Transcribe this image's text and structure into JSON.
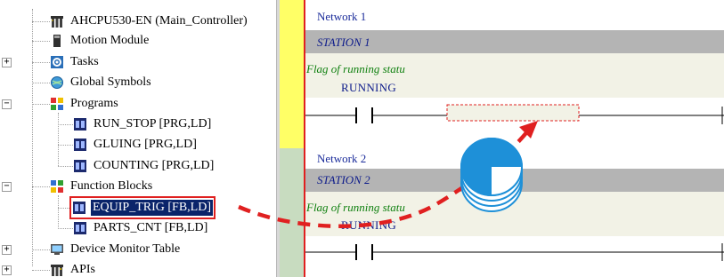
{
  "tree": {
    "items": [
      {
        "label": "AHCPU530-EN  (Main_Controller)",
        "icon": "plc-cpu-icon"
      },
      {
        "label": "Motion Module",
        "icon": "module-icon"
      },
      {
        "label": "Tasks",
        "icon": "tasks-icon",
        "expander": "+"
      },
      {
        "label": "Global Symbols",
        "icon": "globe-icon"
      },
      {
        "label": "Programs",
        "icon": "programs-icon",
        "expander": "−"
      },
      {
        "label": "RUN_STOP [PRG,LD]",
        "icon": "pou-icon"
      },
      {
        "label": "GLUING [PRG,LD]",
        "icon": "pou-icon"
      },
      {
        "label": "COUNTING [PRG,LD]",
        "icon": "pou-icon"
      },
      {
        "label": "Function Blocks",
        "icon": "function-blocks-icon",
        "expander": "−"
      },
      {
        "label": "EQUIP_TRIG [FB,LD]",
        "icon": "pou-icon"
      },
      {
        "label": "PARTS_CNT [FB,LD]",
        "icon": "pou-icon"
      },
      {
        "label": "Device Monitor Table",
        "icon": "monitor-table-icon",
        "expander": "+"
      },
      {
        "label": "APIs",
        "icon": "apis-icon",
        "expander": "+"
      }
    ]
  },
  "ladder": {
    "networks": [
      {
        "title": "Network 1",
        "station": "STATION 1",
        "comment": "Flag of running statu",
        "contact": "RUNNING"
      },
      {
        "title": "Network 2",
        "station": "STATION 2",
        "comment": "Flag of running statu",
        "contact": "RUNNING"
      }
    ]
  },
  "colors": {
    "accent_red": "#e02020",
    "network_title": "#1a2b9a",
    "comment_green": "#108010",
    "gutter_yellow": "#ffff66",
    "gutter_green": "#c8dcc0",
    "selection": "#0a246a",
    "drag_icon": "#1e90d8"
  }
}
